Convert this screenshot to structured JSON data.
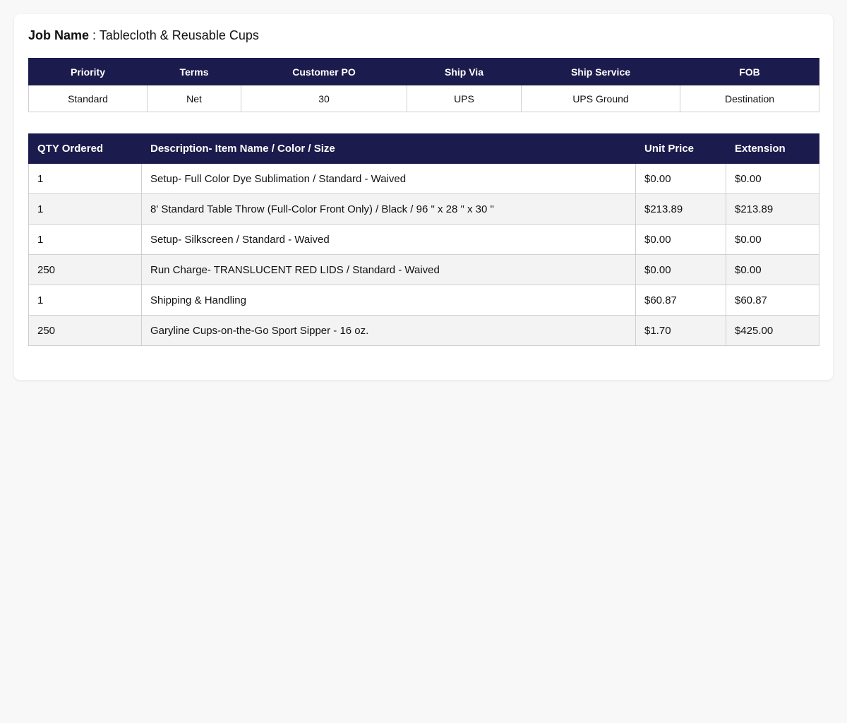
{
  "job": {
    "label": "Job Name",
    "separator": " : ",
    "value": "Tablecloth & Reusable Cups"
  },
  "order_info": {
    "headers": [
      "Priority",
      "Terms",
      "Customer PO",
      "Ship Via",
      "Ship Service",
      "FOB"
    ],
    "values": [
      "Standard",
      "Net",
      "30",
      "UPS",
      "UPS Ground",
      "Destination"
    ]
  },
  "items": {
    "headers": [
      "QTY Ordered",
      "Description- Item Name / Color / Size",
      "Unit Price",
      "Extension"
    ],
    "rows": [
      {
        "qty": "1",
        "description": "Setup- Full Color Dye Sublimation / Standard - Waived",
        "unit_price": "$0.00",
        "extension": "$0.00"
      },
      {
        "qty": "1",
        "description": "8' Standard Table Throw (Full-Color Front Only) / Black / 96 \" x 28 \" x 30 \"",
        "unit_price": "$213.89",
        "extension": "$213.89"
      },
      {
        "qty": "1",
        "description": "Setup- Silkscreen / Standard - Waived",
        "unit_price": "$0.00",
        "extension": "$0.00"
      },
      {
        "qty": "250",
        "description": "Run Charge- TRANSLUCENT RED LIDS / Standard - Waived",
        "unit_price": "$0.00",
        "extension": "$0.00"
      },
      {
        "qty": "1",
        "description": "Shipping & Handling",
        "unit_price": "$60.87",
        "extension": "$60.87"
      },
      {
        "qty": "250",
        "description": "Garyline Cups-on-the-Go Sport Sipper - 16 oz.",
        "unit_price": "$1.70",
        "extension": "$425.00"
      }
    ]
  },
  "colors": {
    "header_bg": "#1c1b4d",
    "header_text": "#ffffff",
    "row_alt_bg": "#f3f3f3",
    "border": "#cfcfcf",
    "page_bg": "#f8f8f8"
  }
}
